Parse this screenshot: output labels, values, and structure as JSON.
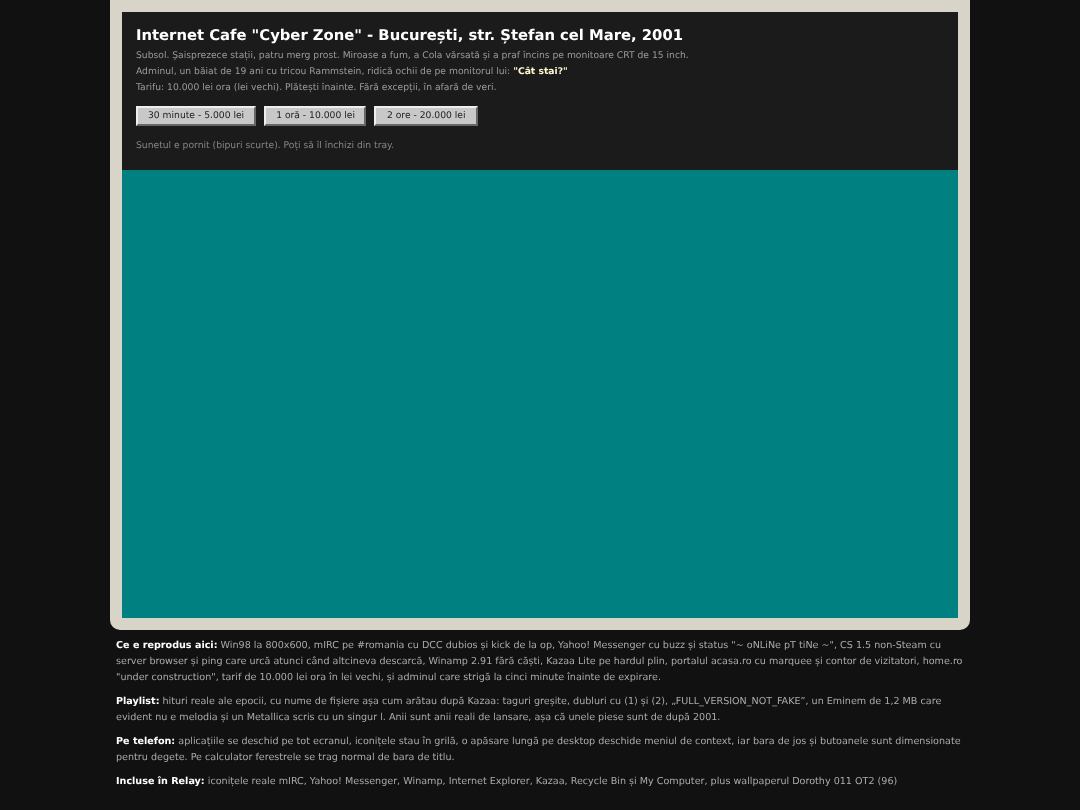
{
  "header": {
    "title": "Internet Cafe \"Cyber Zone\" - București, str. Ștefan cel Mare, 2001",
    "lines": [
      "Subsol. Șaisprezece stații, patru merg prost. Miroase a fum, a Cola vărsată și a praf încins pe monitoare CRT de 15 inch.",
      "Adminul, un băiat de 19 ani cu tricou Rammstein, ridică ochii de pe monitorul lui: **\"Cât stai?\"**",
      "Tarifu: 10.000 lei ora (lei vechi). Plătești înainte. Fără excepții, în afară de veri."
    ],
    "buttons": [
      "30 minute - 5.000 lei",
      "1 oră - 10.000 lei",
      "2 ore - 20.000 lei"
    ],
    "note": "Sunetul e pornit (bipuri scurte). Poți să îl închizi din tray."
  },
  "notes": [
    "**Ce e reprodus aici:** Win98 la 800x600, mIRC pe #romania cu DCC dubios și kick de la op, Yahoo! Messenger cu buzz și status \"~ oNLiNe pT tiNe ~\", CS 1.5 non-Steam cu server browser și ping care urcă atunci când altcineva descarcă, Winamp 2.91 fără căști, Kazaa Lite pe hardul plin, portalul acasa.ro cu marquee și contor de vizitatori, home.ro \"under construction\", tarif de 10.000 lei ora în lei vechi, și adminul care strigă la cinci minute înainte de expirare.",
    "**Playlist:** hituri reale ale epocii, cu nume de fișiere așa cum arătau după Kazaa: taguri greșite, dubluri cu (1) și (2), „FULL_VERSION_NOT_FAKE”, un Eminem de 1,2 MB care evident nu e melodia și un Metallica scris cu un singur l. Anii sunt anii reali de lansare, așa că unele piese sunt de după 2001.",
    "**Pe telefon:** aplicațiile se deschid pe tot ecranul, iconițele stau în grilă, o apăsare lungă pe desktop deschide meniul de context, iar bara de jos și butoanele sunt dimensionate pentru degete. Pe calculator ferestrele se trag normal de bara de titlu.",
    "**Incluse în Relay:** iconițele reale mIRC, Yahoo! Messenger, Winamp, Internet Explorer, Kazaa, Recycle Bin și My Computer, plus wallpaperul Dorothy 011 OT2 (96)"
  ]
}
